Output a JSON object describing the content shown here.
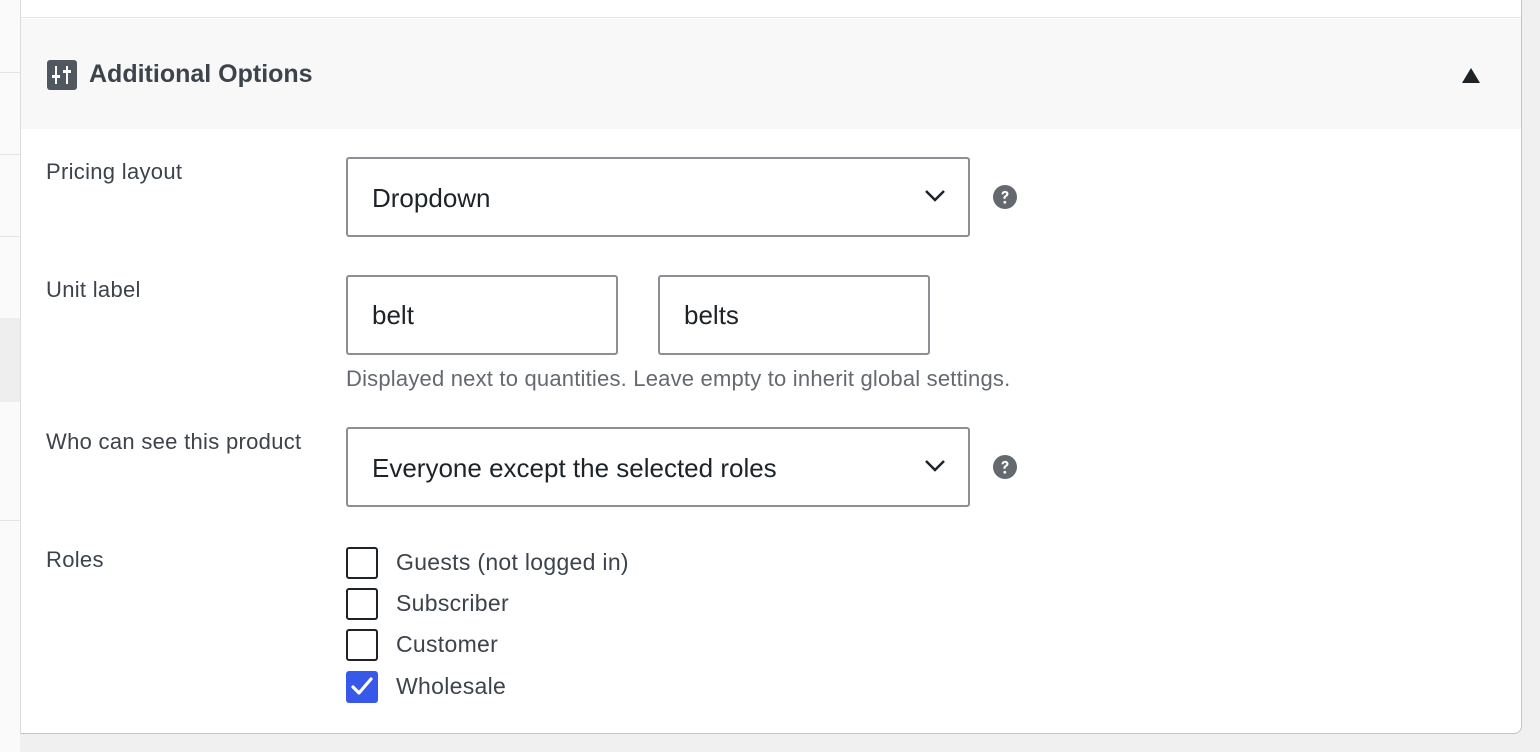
{
  "section": {
    "title": "Additional Options",
    "icon": "sliders-icon",
    "toggle_icon": "triangle-up-icon"
  },
  "pricing_layout": {
    "label": "Pricing layout",
    "value": "Dropdown"
  },
  "unit_label": {
    "label": "Unit label",
    "singular_value": "belt",
    "plural_value": "belts",
    "description": "Displayed next to quantities. Leave empty to inherit global settings."
  },
  "visibility": {
    "label": "Who can see this product",
    "value": "Everyone except the selected roles"
  },
  "roles": {
    "label": "Roles",
    "items": [
      {
        "label": "Guests (not logged in)",
        "checked": false
      },
      {
        "label": "Subscriber",
        "checked": false
      },
      {
        "label": "Customer",
        "checked": false
      },
      {
        "label": "Wholesale",
        "checked": true
      }
    ]
  },
  "colors": {
    "accent": "#3858e9",
    "text": "#3c434a",
    "border": "#8c8f94",
    "header_bg": "#f8f8f8"
  }
}
